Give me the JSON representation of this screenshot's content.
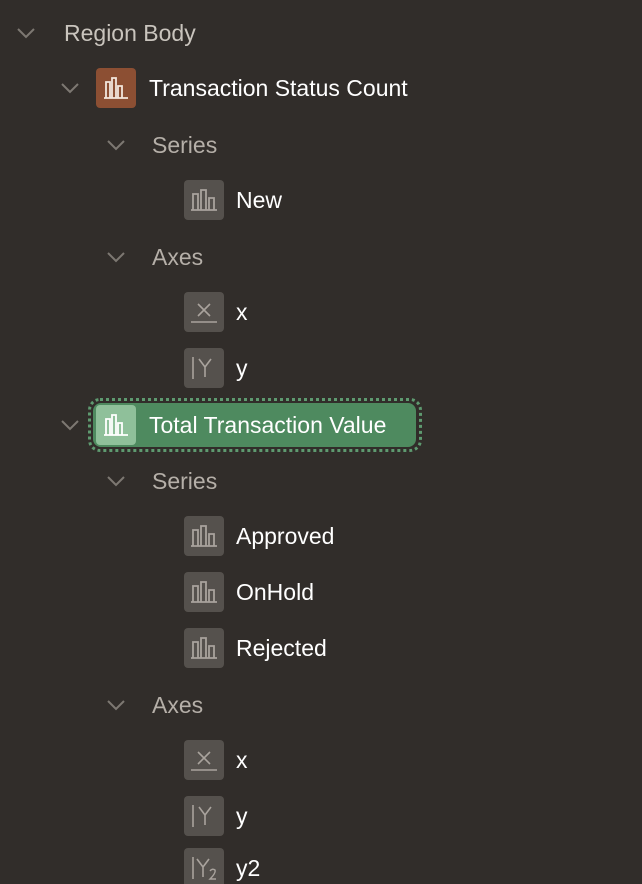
{
  "tree": {
    "root": {
      "label": "Region Body"
    },
    "region1": {
      "label": "Transaction Status Count",
      "icon": "bar-chart-icon",
      "series_label": "Series",
      "series": [
        {
          "label": "New"
        }
      ],
      "axes_label": "Axes",
      "axes": [
        {
          "label": "x",
          "icon": "x-axis-icon"
        },
        {
          "label": "y",
          "icon": "y-axis-icon"
        }
      ]
    },
    "region2": {
      "label": "Total Transaction Value",
      "icon": "bar-chart-icon",
      "selected": true,
      "series_label": "Series",
      "series": [
        {
          "label": "Approved"
        },
        {
          "label": "OnHold"
        },
        {
          "label": "Rejected"
        }
      ],
      "axes_label": "Axes",
      "axes": [
        {
          "label": "x",
          "icon": "x-axis-icon"
        },
        {
          "label": "y",
          "icon": "y-axis-icon"
        },
        {
          "label": "y2",
          "icon": "y2-axis-icon"
        }
      ]
    }
  },
  "colors": {
    "background": "#312d2a",
    "region_icon": "#8c4f33",
    "selected_highlight": "#4e8a5f",
    "neutral_icon": "#55514d"
  }
}
